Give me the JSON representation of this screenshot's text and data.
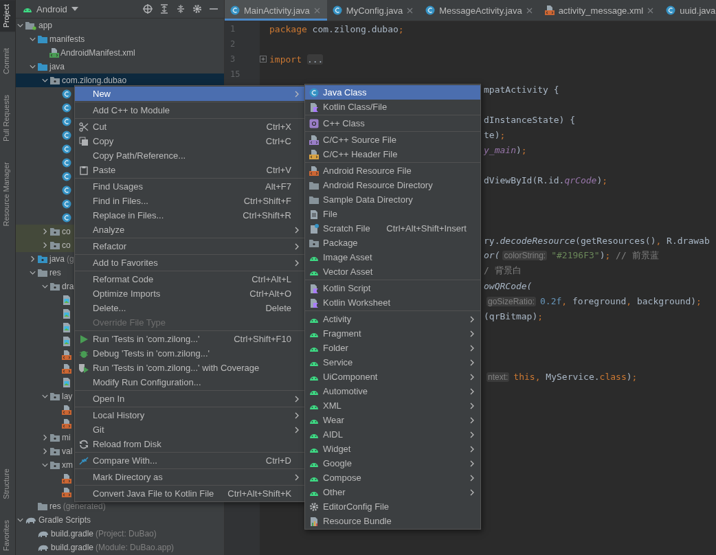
{
  "tool_strip": {
    "top": [
      {
        "label": "Project",
        "selected": true
      },
      {
        "label": "Commit",
        "selected": false
      },
      {
        "label": "Pull Requests",
        "selected": false
      },
      {
        "label": "Resource Manager",
        "selected": false
      }
    ],
    "bottom": [
      {
        "label": "Structure",
        "selected": false
      },
      {
        "label": "Favorites",
        "selected": false
      }
    ]
  },
  "project_panel": {
    "view": "Android",
    "tree": [
      {
        "label": "app",
        "kind": "module",
        "expanded": true,
        "selected": false,
        "children": [
          {
            "label": "manifests",
            "kind": "folder",
            "expanded": true,
            "selected": false,
            "children": [
              {
                "label": "AndroidManifest.xml",
                "kind": "manifest",
                "selected": false
              }
            ]
          },
          {
            "label": "java",
            "kind": "folder",
            "expanded": true,
            "selected": false,
            "children": [
              {
                "label": "com.zilong.dubao",
                "kind": "package",
                "expanded": true,
                "selected": true,
                "children": [
                  {
                    "kind": "class",
                    "selected": false
                  },
                  {
                    "kind": "class",
                    "selected": false
                  },
                  {
                    "kind": "class",
                    "selected": false
                  },
                  {
                    "kind": "class",
                    "selected": false
                  },
                  {
                    "kind": "class",
                    "selected": false
                  },
                  {
                    "kind": "class",
                    "selected": false
                  },
                  {
                    "kind": "class",
                    "selected": false
                  },
                  {
                    "kind": "class",
                    "selected": false
                  },
                  {
                    "kind": "class",
                    "selected": false
                  },
                  {
                    "kind": "class",
                    "selected": false
                  }
                ]
              },
              {
                "label": "co",
                "kind": "test-package",
                "expanded": false,
                "selected": false
              },
              {
                "label": "co",
                "kind": "test-package",
                "expanded": false,
                "selected": false
              }
            ]
          },
          {
            "label": "java",
            "suffix": "(g",
            "kind": "generated-folder",
            "expanded": false,
            "selected": false
          },
          {
            "label": "res",
            "kind": "res-folder",
            "expanded": true,
            "selected": false,
            "children": [
              {
                "label": "dra",
                "kind": "package",
                "expanded": true,
                "selected": false,
                "children": [
                  {
                    "kind": "image",
                    "selected": false
                  },
                  {
                    "kind": "image",
                    "selected": false
                  },
                  {
                    "kind": "image",
                    "selected": false
                  },
                  {
                    "kind": "image",
                    "selected": false
                  },
                  {
                    "kind": "xml",
                    "selected": false
                  },
                  {
                    "kind": "xml",
                    "selected": false
                  },
                  {
                    "kind": "image",
                    "selected": false
                  }
                ]
              },
              {
                "label": "lay",
                "kind": "package",
                "expanded": true,
                "selected": false,
                "children": [
                  {
                    "kind": "xml",
                    "selected": false
                  },
                  {
                    "kind": "xml",
                    "selected": false
                  }
                ]
              },
              {
                "label": "mi",
                "kind": "package",
                "expanded": false,
                "selected": false
              },
              {
                "label": "val",
                "kind": "package",
                "expanded": false,
                "selected": false
              },
              {
                "label": "xm",
                "kind": "package",
                "expanded": true,
                "selected": false,
                "children": [
                  {
                    "kind": "xml",
                    "selected": false
                  },
                  {
                    "kind": "xml",
                    "selected": false
                  }
                ]
              }
            ]
          },
          {
            "label": "res",
            "suffix": "(generated)",
            "kind": "res-folder",
            "selected": false
          }
        ]
      },
      {
        "label": "Gradle Scripts",
        "kind": "gradle",
        "expanded": true,
        "selected": false,
        "children": [
          {
            "label": "build.gradle",
            "suffix": "(Project: DuBao)",
            "kind": "gradle",
            "selected": false
          },
          {
            "label": "build.gradle",
            "suffix": "(Module: DuBao.app)",
            "kind": "gradle",
            "selected": false
          }
        ]
      }
    ]
  },
  "tabs": [
    {
      "label": "MainActivity.java",
      "kind": "java",
      "selected": true,
      "closable": true
    },
    {
      "label": "MyConfig.java",
      "kind": "java",
      "selected": false,
      "closable": true
    },
    {
      "label": "MessageActivity.java",
      "kind": "java",
      "selected": false,
      "closable": true
    },
    {
      "label": "activity_message.xml",
      "kind": "xml",
      "selected": false,
      "closable": true
    },
    {
      "label": "uuid.java",
      "kind": "java",
      "selected": false,
      "closable": false
    }
  ],
  "code": {
    "lines": [
      {
        "kind": "full",
        "number": "1",
        "segments": [
          {
            "kind": "keyword",
            "text": "package"
          },
          {
            "kind": "plain",
            "text": " com.zilong.dubao"
          },
          {
            "kind": "keyword",
            "text": ";"
          }
        ]
      },
      {
        "kind": "full",
        "number": "2"
      },
      {
        "kind": "full",
        "number": "3",
        "folded": true,
        "segments": [
          {
            "kind": "keyword",
            "text": "import"
          },
          {
            "kind": "fold",
            "text": "..."
          }
        ]
      },
      {
        "kind": "full",
        "number": "15"
      },
      {
        "kind": "tail",
        "segments": [
          {
            "kind": "plain",
            "text": "mpatActivity {"
          }
        ]
      },
      {
        "kind": "tail"
      },
      {
        "kind": "tail",
        "segments": [
          {
            "kind": "plain",
            "text": "dInstanceState) {"
          }
        ]
      },
      {
        "kind": "tail",
        "segments": [
          {
            "kind": "plain",
            "text": "te)"
          },
          {
            "kind": "keyword",
            "text": ";"
          }
        ]
      },
      {
        "kind": "tail",
        "segments": [
          {
            "kind": "static",
            "text": "y_main"
          },
          {
            "kind": "plain",
            "text": ")"
          },
          {
            "kind": "keyword",
            "text": ";"
          }
        ]
      },
      {
        "kind": "tail"
      },
      {
        "kind": "tail",
        "segments": [
          {
            "kind": "plain",
            "text": "dViewById(R.id."
          },
          {
            "kind": "static",
            "text": "qrCode"
          },
          {
            "kind": "plain",
            "text": ")"
          },
          {
            "kind": "keyword",
            "text": ";"
          }
        ]
      },
      {
        "kind": "tail"
      },
      {
        "kind": "tail"
      },
      {
        "kind": "tail"
      },
      {
        "kind": "tail",
        "segments": [
          {
            "kind": "plain",
            "text": "ry."
          },
          {
            "kind": "method",
            "text": "decodeResource"
          },
          {
            "kind": "plain",
            "text": "(getResources()"
          },
          {
            "kind": "keyword",
            "text": ","
          },
          {
            "kind": "plain",
            "text": " R.drawab"
          }
        ]
      },
      {
        "kind": "tail",
        "segments": [
          {
            "kind": "method",
            "text": "or("
          },
          {
            "kind": "hint",
            "text": "colorString:"
          },
          {
            "kind": "string",
            "text": "\"#2196F3\""
          },
          {
            "kind": "plain",
            "text": ")"
          },
          {
            "kind": "keyword",
            "text": ";"
          },
          {
            "kind": "comment",
            "text": " // 前景蓝"
          }
        ]
      },
      {
        "kind": "tail",
        "segments": [
          {
            "kind": "comment",
            "text": "/ 背景白"
          }
        ]
      },
      {
        "kind": "tail",
        "segments": [
          {
            "kind": "method",
            "text": "owQRCode("
          }
        ]
      },
      {
        "kind": "tail",
        "segments": [
          {
            "kind": "hint",
            "text": "goSizeRatio:"
          },
          {
            "kind": "number",
            "text": "0.2f"
          },
          {
            "kind": "keyword",
            "text": ","
          },
          {
            "kind": "plain",
            "text": " foreground"
          },
          {
            "kind": "keyword",
            "text": ","
          },
          {
            "kind": "plain",
            "text": " background)"
          },
          {
            "kind": "keyword",
            "text": ";"
          }
        ]
      },
      {
        "kind": "tail",
        "segments": [
          {
            "kind": "plain",
            "text": "(qrBitmap)"
          },
          {
            "kind": "keyword",
            "text": ";"
          }
        ]
      },
      {
        "kind": "tail"
      },
      {
        "kind": "tail"
      },
      {
        "kind": "tail"
      },
      {
        "kind": "tail",
        "segments": [
          {
            "kind": "hint",
            "text": "ntext:"
          },
          {
            "kind": "keyword",
            "text": "this,"
          },
          {
            "kind": "plain",
            "text": " MyService."
          },
          {
            "kind": "keyword",
            "text": "class"
          },
          {
            "kind": "plain",
            "text": ")"
          },
          {
            "kind": "keyword",
            "text": ";"
          }
        ]
      }
    ]
  },
  "context_menu": {
    "groups": [
      [
        {
          "label": "New",
          "kind": "plain",
          "submenu": true,
          "selected": true,
          "disabled": false
        }
      ],
      [
        {
          "label": "Add C++ to Module",
          "kind": "plain",
          "submenu": false,
          "selected": false,
          "disabled": false
        }
      ],
      [
        {
          "label": "Cut",
          "kind": "cut",
          "shortcut": "Ctrl+X",
          "submenu": false,
          "selected": false,
          "disabled": false
        },
        {
          "label": "Copy",
          "kind": "copy",
          "shortcut": "Ctrl+C",
          "submenu": false,
          "selected": false,
          "disabled": false
        },
        {
          "label": "Copy Path/Reference...",
          "kind": "plain",
          "submenu": false,
          "selected": false,
          "disabled": false
        },
        {
          "label": "Paste",
          "kind": "paste",
          "shortcut": "Ctrl+V",
          "submenu": false,
          "selected": false,
          "disabled": false
        }
      ],
      [
        {
          "label": "Find Usages",
          "kind": "plain",
          "shortcut": "Alt+F7",
          "submenu": false,
          "selected": false,
          "disabled": false
        },
        {
          "label": "Find in Files...",
          "kind": "plain",
          "shortcut": "Ctrl+Shift+F",
          "submenu": false,
          "selected": false,
          "disabled": false
        },
        {
          "label": "Replace in Files...",
          "kind": "plain",
          "shortcut": "Ctrl+Shift+R",
          "submenu": false,
          "selected": false,
          "disabled": false
        },
        {
          "label": "Analyze",
          "kind": "plain",
          "submenu": true,
          "selected": false,
          "disabled": false
        }
      ],
      [
        {
          "label": "Refactor",
          "kind": "plain",
          "submenu": true,
          "selected": false,
          "disabled": false
        }
      ],
      [
        {
          "label": "Add to Favorites",
          "kind": "plain",
          "submenu": true,
          "selected": false,
          "disabled": false
        }
      ],
      [
        {
          "label": "Reformat Code",
          "kind": "plain",
          "shortcut": "Ctrl+Alt+L",
          "submenu": false,
          "selected": false,
          "disabled": false
        },
        {
          "label": "Optimize Imports",
          "kind": "plain",
          "shortcut": "Ctrl+Alt+O",
          "submenu": false,
          "selected": false,
          "disabled": false
        },
        {
          "label": "Delete...",
          "kind": "plain",
          "shortcut": "Delete",
          "submenu": false,
          "selected": false,
          "disabled": false
        },
        {
          "label": "Override File Type",
          "kind": "plain",
          "submenu": false,
          "selected": false,
          "disabled": true
        }
      ],
      [
        {
          "label": "Run 'Tests in 'com.zilong...'",
          "kind": "run",
          "shortcut": "Ctrl+Shift+F10",
          "submenu": false,
          "selected": false,
          "disabled": false
        },
        {
          "label": "Debug 'Tests in 'com.zilong...'",
          "kind": "debug",
          "submenu": false,
          "selected": false,
          "disabled": false
        },
        {
          "label": "Run 'Tests in 'com.zilong...' with Coverage",
          "kind": "coverage",
          "submenu": false,
          "selected": false,
          "disabled": false
        },
        {
          "label": "Modify Run Configuration...",
          "kind": "plain",
          "submenu": false,
          "selected": false,
          "disabled": false
        }
      ],
      [
        {
          "label": "Open In",
          "kind": "plain",
          "submenu": true,
          "selected": false,
          "disabled": false
        }
      ],
      [
        {
          "label": "Local History",
          "kind": "plain",
          "submenu": true,
          "selected": false,
          "disabled": false
        },
        {
          "label": "Git",
          "kind": "plain",
          "submenu": true,
          "selected": false,
          "disabled": false
        },
        {
          "label": "Reload from Disk",
          "kind": "reload",
          "submenu": false,
          "selected": false,
          "disabled": false
        }
      ],
      [
        {
          "label": "Compare With...",
          "kind": "compare",
          "shortcut": "Ctrl+D",
          "submenu": false,
          "selected": false,
          "disabled": false
        }
      ],
      [
        {
          "label": "Mark Directory as",
          "kind": "plain",
          "submenu": true,
          "selected": false,
          "disabled": false
        }
      ],
      [
        {
          "label": "Convert Java File to Kotlin File",
          "kind": "plain",
          "shortcut": "Ctrl+Alt+Shift+K",
          "submenu": false,
          "selected": false,
          "disabled": false
        }
      ]
    ]
  },
  "new_submenu": {
    "groups": [
      [
        {
          "label": "Java Class",
          "kind": "java",
          "submenu": false,
          "selected": true
        },
        {
          "label": "Kotlin Class/File",
          "kind": "kotlin",
          "submenu": false,
          "selected": false
        }
      ],
      [
        {
          "label": "C++ Class",
          "kind": "cpp-class",
          "submenu": false,
          "selected": false
        }
      ],
      [
        {
          "label": "C/C++ Source File",
          "kind": "cpp-source",
          "submenu": false,
          "selected": false
        },
        {
          "label": "C/C++ Header File",
          "kind": "cpp-header",
          "submenu": false,
          "selected": false
        }
      ],
      [
        {
          "label": "Android Resource File",
          "kind": "resource",
          "submenu": false,
          "selected": false
        },
        {
          "label": "Android Resource Directory",
          "kind": "folder",
          "submenu": false,
          "selected": false
        },
        {
          "label": "Sample Data Directory",
          "kind": "folder",
          "submenu": false,
          "selected": false
        },
        {
          "label": "File",
          "kind": "file",
          "submenu": false,
          "selected": false
        },
        {
          "label": "Scratch File",
          "kind": "scratch",
          "shortcut": "Ctrl+Alt+Shift+Insert",
          "submenu": false,
          "selected": false
        },
        {
          "label": "Package",
          "kind": "package",
          "submenu": false,
          "selected": false
        },
        {
          "label": "Image Asset",
          "kind": "android",
          "submenu": false,
          "selected": false
        },
        {
          "label": "Vector Asset",
          "kind": "android",
          "submenu": false,
          "selected": false
        }
      ],
      [
        {
          "label": "Kotlin Script",
          "kind": "kotlin",
          "submenu": false,
          "selected": false
        },
        {
          "label": "Kotlin Worksheet",
          "kind": "kotlin",
          "submenu": false,
          "selected": false
        }
      ],
      [
        {
          "label": "Activity",
          "kind": "android",
          "submenu": true,
          "selected": false
        },
        {
          "label": "Fragment",
          "kind": "android",
          "submenu": true,
          "selected": false
        },
        {
          "label": "Folder",
          "kind": "android",
          "submenu": true,
          "selected": false
        },
        {
          "label": "Service",
          "kind": "android",
          "submenu": true,
          "selected": false
        },
        {
          "label": "UiComponent",
          "kind": "android",
          "submenu": true,
          "selected": false
        },
        {
          "label": "Automotive",
          "kind": "android",
          "submenu": true,
          "selected": false
        },
        {
          "label": "XML",
          "kind": "android",
          "submenu": true,
          "selected": false
        },
        {
          "label": "Wear",
          "kind": "android",
          "submenu": true,
          "selected": false
        },
        {
          "label": "AIDL",
          "kind": "android",
          "submenu": true,
          "selected": false
        },
        {
          "label": "Widget",
          "kind": "android",
          "submenu": true,
          "selected": false
        },
        {
          "label": "Google",
          "kind": "android",
          "submenu": true,
          "selected": false
        },
        {
          "label": "Compose",
          "kind": "android",
          "submenu": true,
          "selected": false
        },
        {
          "label": "Other",
          "kind": "android",
          "submenu": true,
          "selected": false
        },
        {
          "label": "EditorConfig File",
          "kind": "gear",
          "submenu": false,
          "selected": false
        },
        {
          "label": "Resource Bundle",
          "kind": "bundle",
          "submenu": false,
          "selected": false
        }
      ]
    ]
  }
}
